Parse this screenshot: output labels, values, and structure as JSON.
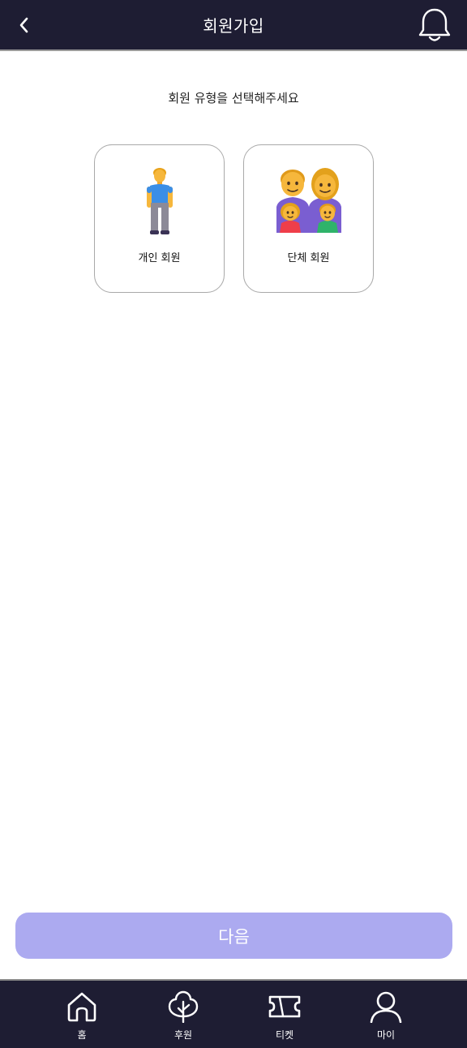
{
  "header": {
    "title": "회원가입",
    "back_icon": "chevron-left-icon",
    "notification_icon": "bell-icon"
  },
  "prompt": "회원 유형을 선택해주세요",
  "member_types": [
    {
      "label": "개인 회원",
      "icon": "person-standing-icon"
    },
    {
      "label": "단체 회원",
      "icon": "family-icon"
    }
  ],
  "next_button": {
    "label": "다음",
    "color": "#acaaf0"
  },
  "tabbar": {
    "background": "#1e1d33",
    "items": [
      {
        "label": "홈",
        "icon": "home-icon"
      },
      {
        "label": "후원",
        "icon": "tree-icon"
      },
      {
        "label": "티켓",
        "icon": "ticket-icon"
      },
      {
        "label": "마이",
        "icon": "user-icon"
      }
    ]
  }
}
